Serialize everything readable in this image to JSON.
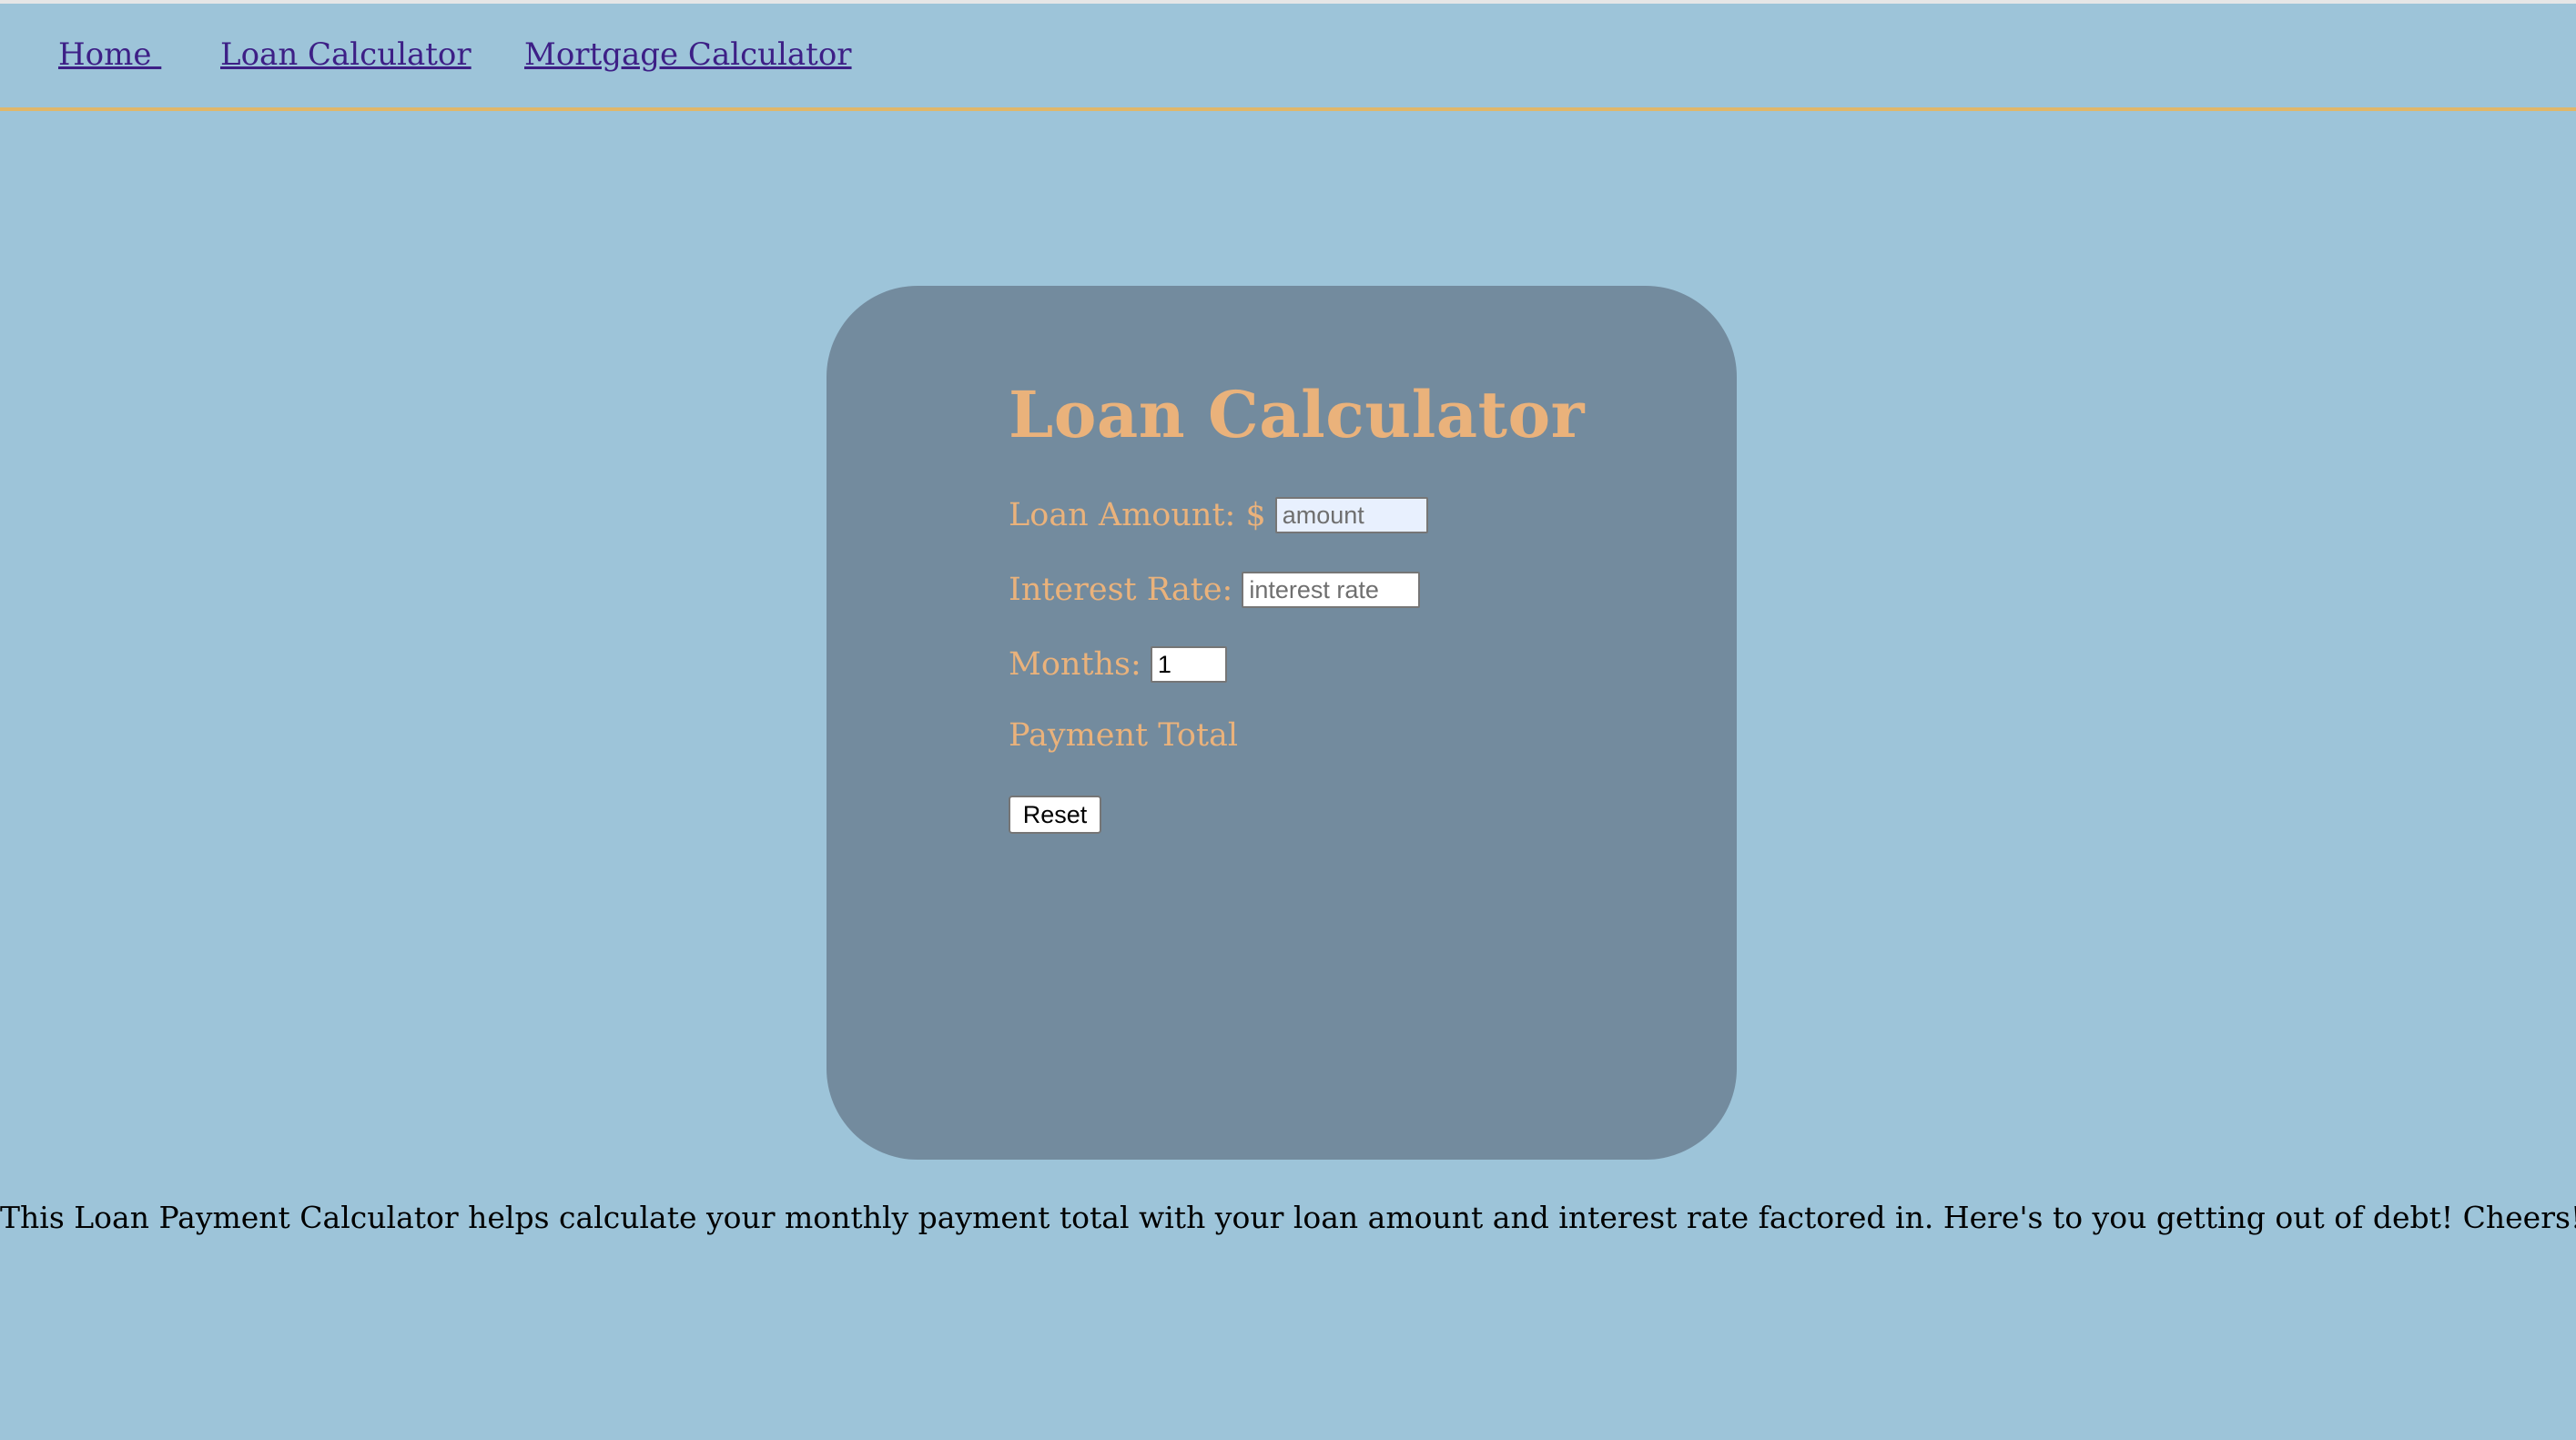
{
  "nav": {
    "home": "Home ",
    "loan_calculator": "Loan Calculator",
    "mortgage_calculator": "Mortgage Calculator"
  },
  "calculator": {
    "title": "Loan Calculator",
    "loan_amount_label": "Loan Amount: $",
    "loan_amount_placeholder": "amount",
    "loan_amount_value": "",
    "interest_rate_label": "Interest Rate:",
    "interest_rate_placeholder": "interest rate",
    "interest_rate_value": "",
    "months_label": "Months:",
    "months_value": "1",
    "payment_total_label": "Payment Total",
    "reset_label": "Reset"
  },
  "description": "This Loan Payment Calculator helps calculate your monthly payment total with your loan amount and interest rate factored in. Here's to you getting out of debt! Cheers!",
  "colors": {
    "background": "#9dc4d9",
    "card": "#738b9e",
    "accent_text": "#eab27b",
    "nav_link": "#3d1f86",
    "nav_border": "#e0b76a"
  }
}
